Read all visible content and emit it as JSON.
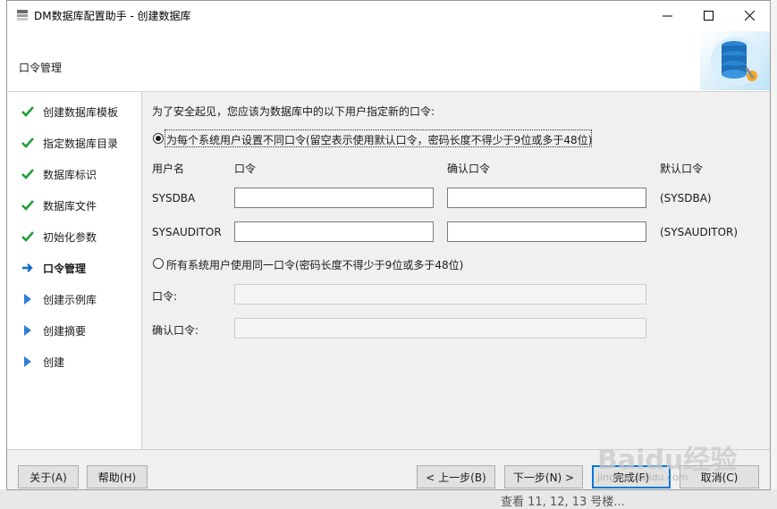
{
  "window": {
    "title": "DM数据库配置助手 - 创建数据库",
    "header_title": "口令管理"
  },
  "steps": [
    {
      "label": "创建数据库模板",
      "status": "done"
    },
    {
      "label": "指定数据库目录",
      "status": "done"
    },
    {
      "label": "数据库标识",
      "status": "done"
    },
    {
      "label": "数据库文件",
      "status": "done"
    },
    {
      "label": "初始化参数",
      "status": "done"
    },
    {
      "label": "口令管理",
      "status": "current"
    },
    {
      "label": "创建示例库",
      "status": "pending"
    },
    {
      "label": "创建摘要",
      "status": "pending"
    },
    {
      "label": "创建",
      "status": "pending"
    }
  ],
  "content": {
    "intro": "为了安全起见，您应该为数据库中的以下用户指定新的口令:",
    "option_separate": "为每个系统用户设置不同口令(留空表示使用默认口令，密码长度不得少于9位或多于48位)",
    "col_user": "用户名",
    "col_password": "口令",
    "col_confirm": "确认口令",
    "col_default": "默认口令",
    "users": [
      {
        "name": "SYSDBA",
        "password": "",
        "confirm": "",
        "default": "(SYSDBA)"
      },
      {
        "name": "SYSAUDITOR",
        "password": "",
        "confirm": "",
        "default": "(SYSAUDITOR)"
      }
    ],
    "option_same": "所有系统用户使用同一口令(密码长度不得少于9位或多于48位)",
    "same_password_label": "口令:",
    "same_confirm_label": "确认口令:"
  },
  "buttons": {
    "about": "关于(A)",
    "help": "帮助(H)",
    "prev": "< 上一步(B)",
    "next": "下一步(N) >",
    "finish": "完成(F)",
    "cancel": "取消(C)"
  },
  "background": {
    "taskbar_text": "查看 11, 12, 13 号楼..."
  },
  "watermark": {
    "text": "Baidu经验",
    "url": "jingyan.baidu.com"
  },
  "colors": {
    "check": "#1f9e3a",
    "arrow_current": "#1a6dc4",
    "triangle_pending": "#2f7fd6",
    "accent": "#0078d7"
  }
}
